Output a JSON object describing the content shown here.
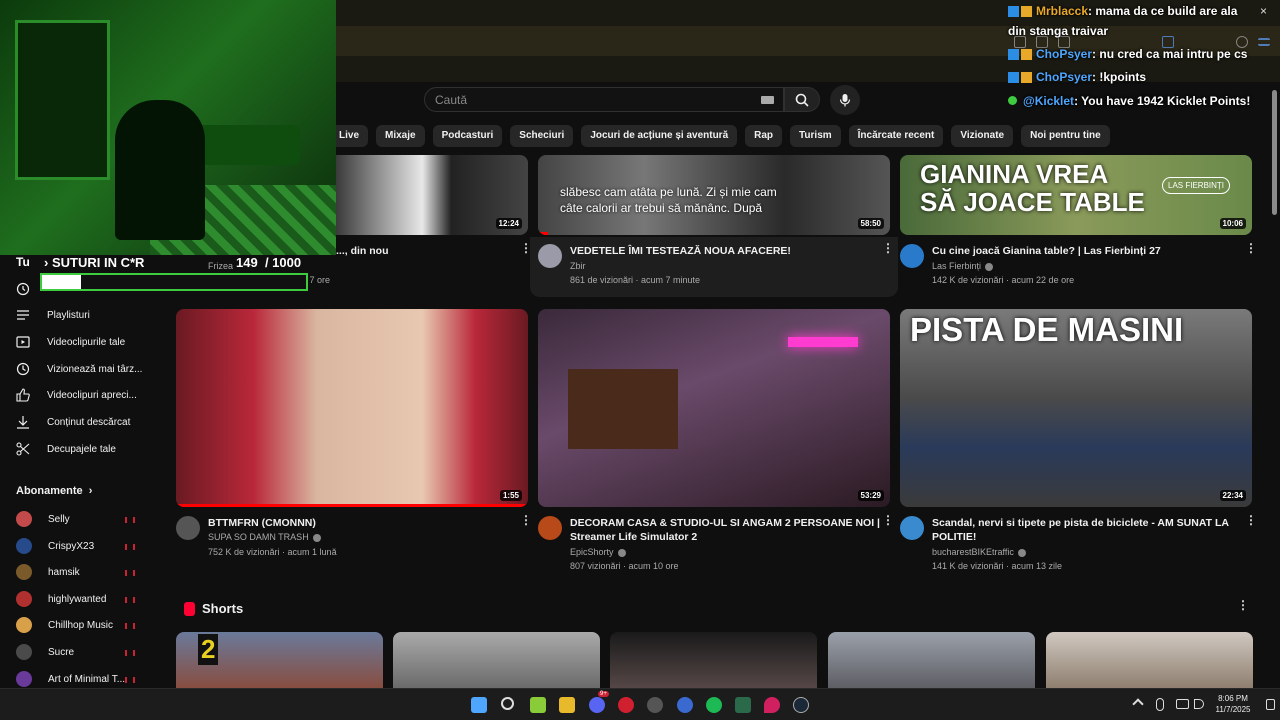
{
  "header": {
    "search_placeholder": "Caută"
  },
  "chips": [
    "Live",
    "Mixaje",
    "Podcasturi",
    "Scheciuri",
    "Jocuri de acțiune și aventură",
    "Rap",
    "Turism",
    "Încărcate recent",
    "Vizionate",
    "Noi pentru tine"
  ],
  "sidebar": {
    "you_label": "Tu",
    "items": [
      {
        "label": "Playlisturi",
        "icon": "playlist-icon"
      },
      {
        "label": "Videoclipurile tale",
        "icon": "video-icon"
      },
      {
        "label": "Vizionează mai târz...",
        "icon": "clock-icon"
      },
      {
        "label": "Videoclipuri apreci...",
        "icon": "like-icon"
      },
      {
        "label": "Conținut descărcat",
        "icon": "download-icon"
      },
      {
        "label": "Decupajele tale",
        "icon": "scissors-icon"
      }
    ],
    "subscriptions_title": "Abonamente",
    "subscriptions": [
      {
        "name": "Selly",
        "color": "#c24a4a"
      },
      {
        "name": "CrispyX23",
        "color": "#264a8a"
      },
      {
        "name": "hamsik",
        "color": "#7a5a2a"
      },
      {
        "name": "highlywanted",
        "color": "#b03030"
      },
      {
        "name": "Chillhop Music",
        "color": "#d9a04a"
      },
      {
        "name": "Sucre",
        "color": "#4a4a4a"
      },
      {
        "name": "Art of Minimal T...",
        "color": "#6a3a9a"
      }
    ]
  },
  "row1": [
    {
      "title": "..., din nou",
      "channel": "Frizea",
      "meta": "2,6 K de vizionări · acum 7 ore",
      "duration": "12:24"
    },
    {
      "title": "VEDETELE ÎMI TESTEAZĂ NOUA AFACERE!",
      "channel": "Zbir",
      "meta": "861 de vizionări · acum 7 minute",
      "duration": "58:50",
      "caption1": "slăbesc cam atâta pe lună. Zi și mie cam",
      "caption2": "câte calorii ar trebui să mănânc. După"
    },
    {
      "title": "Cu cine joacă Gianina table? | Las Fierbinți 27",
      "channel": "Las Fierbinți",
      "meta": "142 K de vizionări · acum 22 de ore",
      "duration": "10:06",
      "thumb_text1": "GIANINA VREA",
      "thumb_text2": "SĂ JOACE TABLE",
      "thumb_logo": "LAS FIERBINȚI"
    }
  ],
  "row2": [
    {
      "title": "BTTMFRN (CMONNN)",
      "channel": "SUPA SO DAMN TRASH",
      "meta": "752 K de vizionări · acum 1 lună",
      "duration": "1:55"
    },
    {
      "title1": "DECORAM CASA & STUDIO-UL SI ANGAM 2 PERSOANE NOI |",
      "title2": "Streamer Life Simulator 2",
      "channel": "EpicShorty",
      "meta": "807 vizionări · acum 10 ore",
      "duration": "53:29"
    },
    {
      "title1": "Scandal, nervi si tipete pe pista de biciclete - AM SUNAT LA",
      "title2": "POLITIE!",
      "channel": "bucharestBIKEtraffic",
      "meta": "141 K de vizionări · acum 13 zile",
      "duration": "22:34",
      "thumb_text": "PISTA DE MASINI"
    }
  ],
  "shorts": {
    "title": "Shorts",
    "short1_label": "2"
  },
  "overlay": {
    "goal_prefix": "Tu",
    "goal_title": "SUTURI IN C*R",
    "goal_current": "149",
    "goal_target": "/ 1000",
    "goal_fraction": 0.149
  },
  "chat": [
    {
      "user": "Mrblacck",
      "user_color": "#e8a92a",
      "text": ": mama da ce build are ala",
      "text2": "din stanga traivar"
    },
    {
      "user": "ChoPsyer",
      "user_color": "#4fa6ff",
      "text": ": nu cred ca mai intru pe cs"
    },
    {
      "user": "ChoPsyer",
      "user_color": "#4fa6ff",
      "text": ": !kpoints"
    },
    {
      "user": "@Kicklet",
      "user_color": "#4fa6ff",
      "text": ": You have 1942 Kicklet Points!"
    }
  ],
  "taskbar": {
    "time": "8:06 PM",
    "date": "11/7/2025",
    "badge": "9+"
  }
}
